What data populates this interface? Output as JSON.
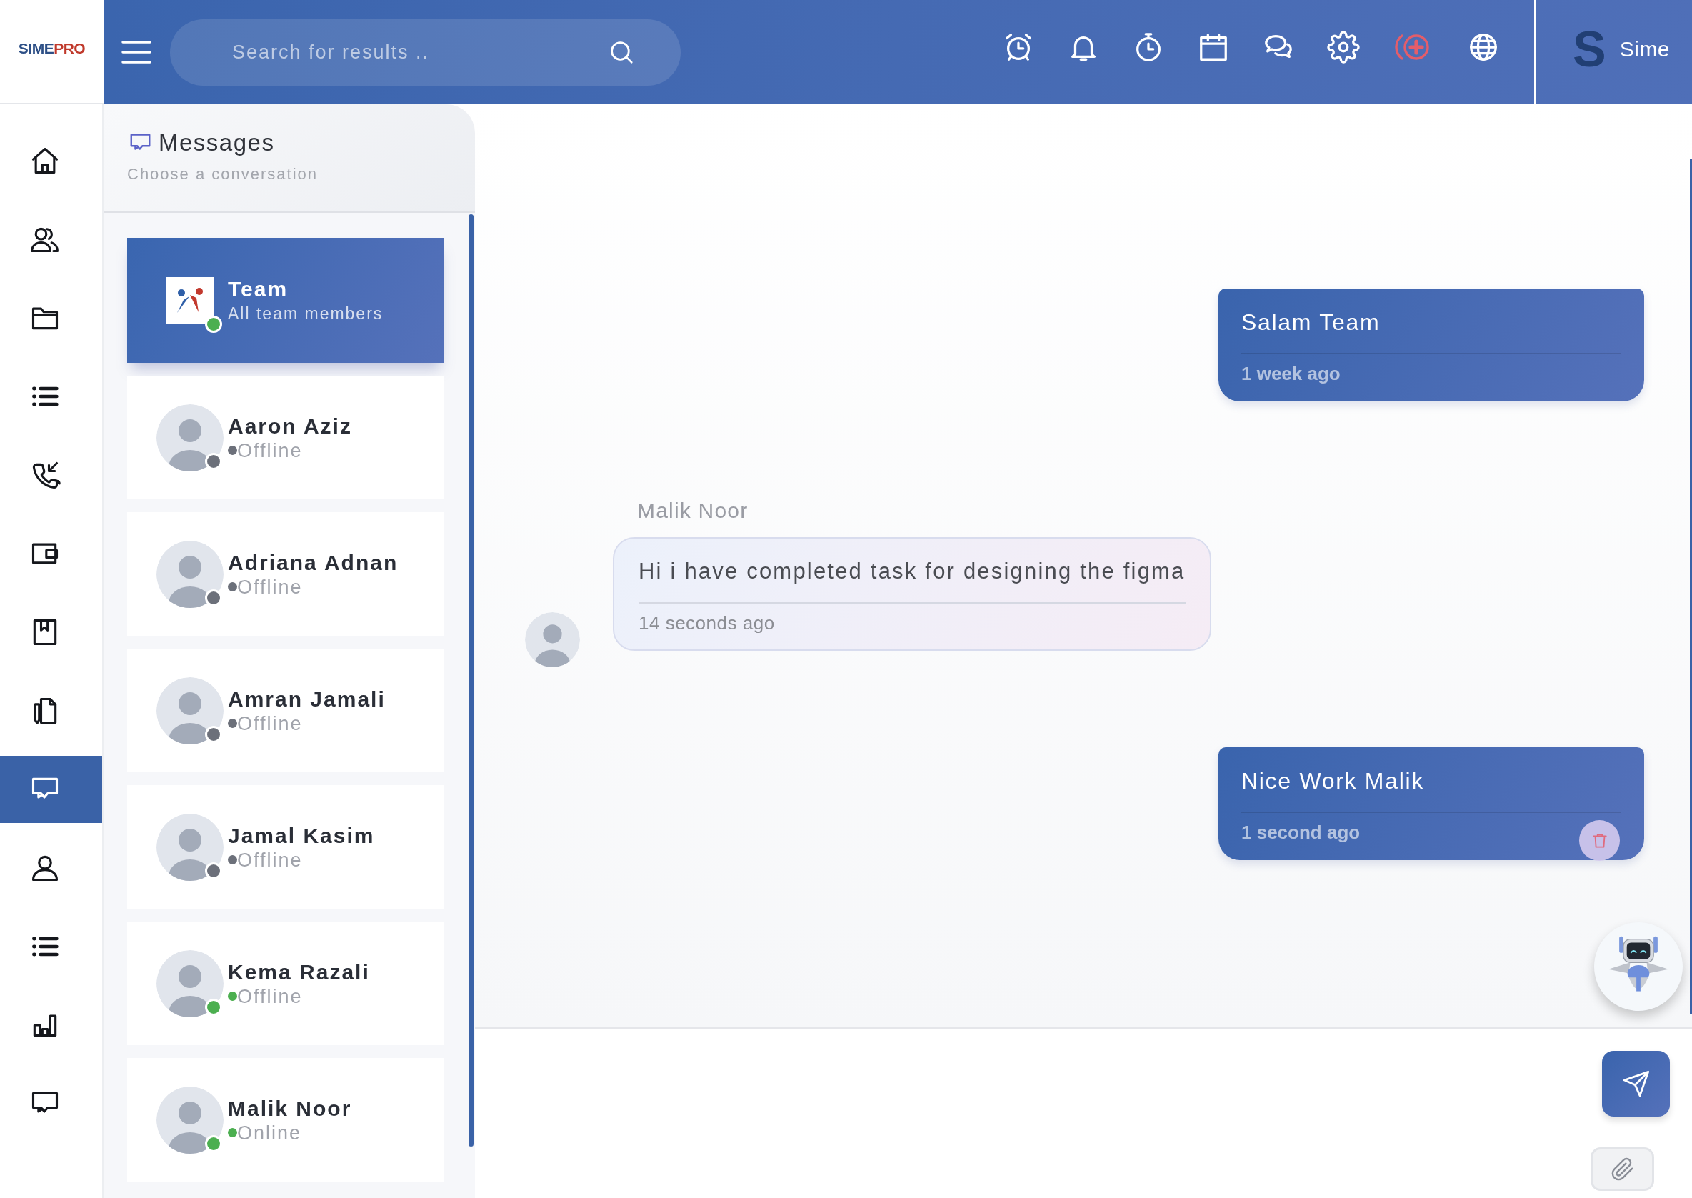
{
  "header": {
    "logo": {
      "word": "SIME",
      "accent": "PRO"
    },
    "search": {
      "placeholder": "Search for results .."
    },
    "user": {
      "initial": "S",
      "name": "Sime"
    }
  },
  "nav": [
    {
      "selected": false
    },
    {
      "selected": false
    },
    {
      "selected": false
    },
    {
      "selected": false
    },
    {
      "selected": false
    },
    {
      "selected": false
    },
    {
      "selected": false
    },
    {
      "selected": false
    },
    {
      "selected": true
    },
    {
      "selected": false
    },
    {
      "selected": false
    },
    {
      "selected": false
    },
    {
      "selected": false
    }
  ],
  "messages_panel": {
    "title": "Messages",
    "subtitle": "Choose a conversation",
    "conversations": [
      {
        "kind": "group",
        "name": "Team",
        "status": "All team members",
        "color": "#4caf50",
        "selected": true
      },
      {
        "kind": "person",
        "name": "Aaron Aziz",
        "status": "Offline",
        "color": "#6c707a",
        "selected": false
      },
      {
        "kind": "person",
        "name": "Adriana Adnan",
        "status": "Offline",
        "color": "#6c707a",
        "selected": false
      },
      {
        "kind": "person",
        "name": "Amran Jamali",
        "status": "Offline",
        "color": "#6c707a",
        "selected": false
      },
      {
        "kind": "person",
        "name": "Jamal Kasim",
        "status": "Offline",
        "color": "#6c707a",
        "selected": false
      },
      {
        "kind": "person",
        "name": "Kema Razali",
        "status": "Offline",
        "color": "#4caf50",
        "selected": false
      },
      {
        "kind": "person",
        "name": "Malik Noor",
        "status": "Online",
        "color": "#4caf50",
        "selected": false
      }
    ]
  },
  "chat": {
    "messages": [
      {
        "kind": "sent",
        "text": "Salam Team",
        "time": "1 week ago",
        "deletable": false
      },
      {
        "kind": "received",
        "sender": "Malik Noor",
        "text": "Hi i have completed task for designing the figma",
        "time": "14 seconds ago"
      },
      {
        "kind": "sent",
        "text": "Nice Work Malik",
        "time": "1 second ago",
        "deletable": true
      }
    ]
  }
}
